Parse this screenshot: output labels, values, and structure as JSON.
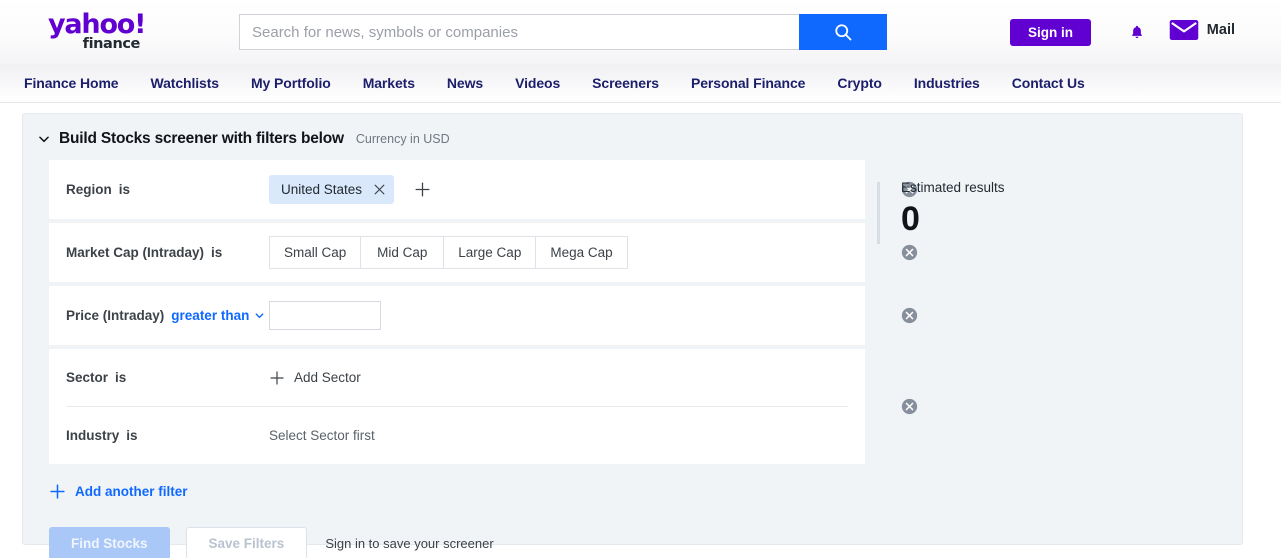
{
  "header": {
    "logo_yahoo": "yahoo!",
    "logo_finance": "finance",
    "search_placeholder": "Search for news, symbols or companies",
    "search_value": "",
    "signin_label": "Sign in",
    "mail_label": "Mail",
    "accent_purple": "#6001d2",
    "accent_blue": "#0f69ff"
  },
  "nav": {
    "items": [
      {
        "label": "Finance Home"
      },
      {
        "label": "Watchlists"
      },
      {
        "label": "My Portfolio"
      },
      {
        "label": "Markets"
      },
      {
        "label": "News"
      },
      {
        "label": "Videos"
      },
      {
        "label": "Screeners"
      },
      {
        "label": "Personal Finance"
      },
      {
        "label": "Crypto"
      },
      {
        "label": "Industries"
      },
      {
        "label": "Contact Us"
      }
    ]
  },
  "screener": {
    "title": "Build Stocks screener with filters below",
    "currency_note": "Currency in USD",
    "filters": {
      "region": {
        "label": "Region",
        "operator": "is",
        "chip_value": "United States"
      },
      "market_cap": {
        "label": "Market Cap (Intraday)",
        "operator": "is",
        "options": [
          "Small Cap",
          "Mid Cap",
          "Large Cap",
          "Mega Cap"
        ]
      },
      "price": {
        "label": "Price (Intraday)",
        "operator": "greater than",
        "value": ""
      },
      "sector": {
        "label": "Sector",
        "operator": "is",
        "add_label": "Add Sector"
      },
      "industry": {
        "label": "Industry",
        "operator": "is",
        "placeholder": "Select Sector first"
      }
    },
    "add_filter_label": "Add another filter",
    "find_stocks_label": "Find Stocks",
    "save_filters_label": "Save Filters",
    "save_hint": "Sign in to save your screener"
  },
  "results": {
    "label": "Estimated results",
    "value": "0"
  }
}
